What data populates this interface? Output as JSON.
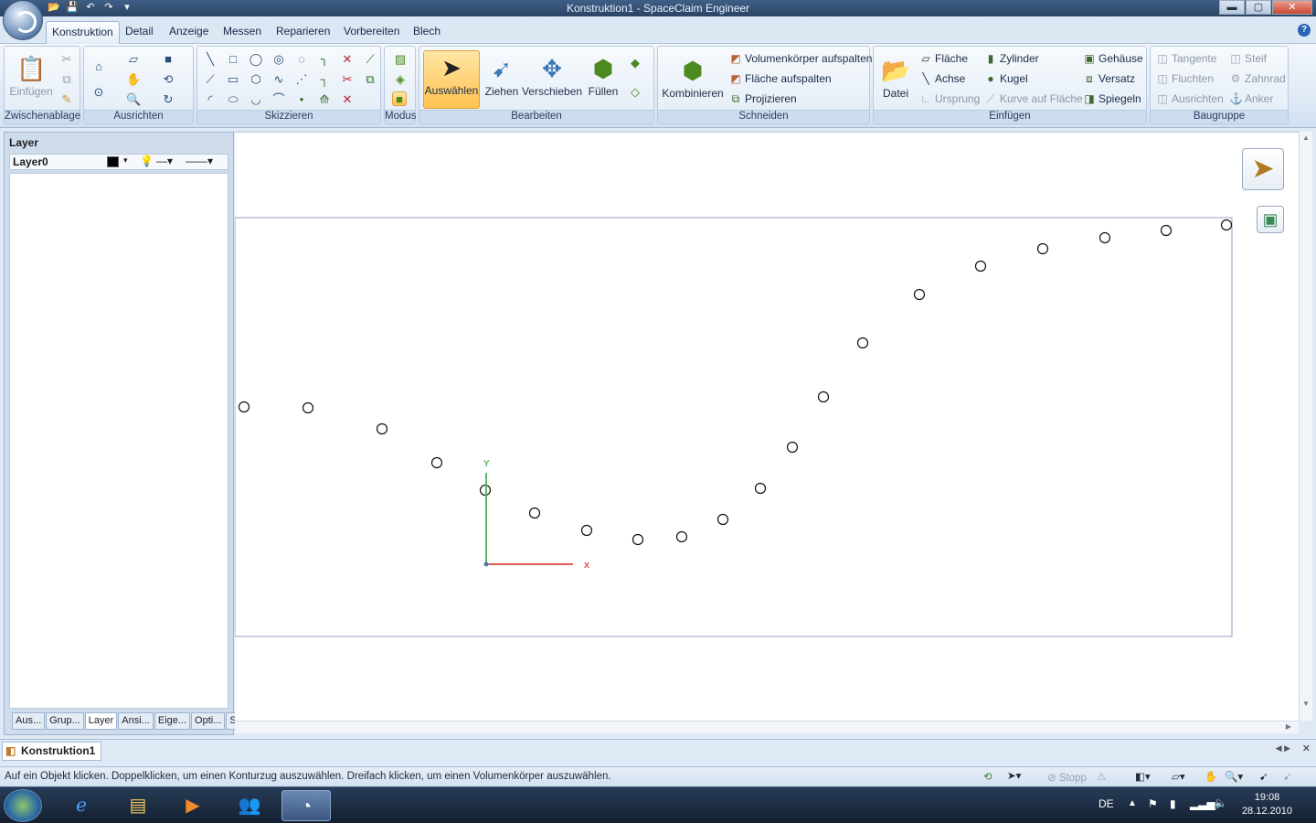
{
  "title": "Konstruktion1 - SpaceClaim Engineer",
  "window_buttons": {
    "minimize": "▬",
    "maximize": "▢",
    "close": "✕"
  },
  "qat_icons": [
    "open-icon",
    "save-icon",
    "undo-icon",
    "redo-icon",
    "customize-icon"
  ],
  "tabs": [
    {
      "label": "Konstruktion",
      "active": true
    },
    {
      "label": "Detail"
    },
    {
      "label": "Anzeige"
    },
    {
      "label": "Messen"
    },
    {
      "label": "Reparieren"
    },
    {
      "label": "Vorbereiten"
    },
    {
      "label": "Blech"
    }
  ],
  "ribbon": {
    "clipboard": {
      "label": "Zwischenablage",
      "paste": "Einfügen"
    },
    "orient": {
      "label": "Ausrichten"
    },
    "sketch": {
      "label": "Skizzieren"
    },
    "mode": {
      "label": "Modus"
    },
    "edit": {
      "label": "Bearbeiten",
      "select": "Auswählen",
      "pull": "Ziehen",
      "move": "Verschieben",
      "fill": "Füllen"
    },
    "intersect": {
      "label": "Schneiden",
      "combine": "Kombinieren",
      "split_body": "Volumenkörper aufspalten",
      "split_face": "Fläche aufspalten",
      "project": "Projizieren"
    },
    "insert": {
      "label": "Einfügen",
      "file": "Datei",
      "plane": "Fläche",
      "axis": "Achse",
      "origin": "Ursprung",
      "cylinder": "Zylinder",
      "sphere": "Kugel",
      "curve_on_face": "Kurve auf Fläche",
      "shell": "Gehäuse",
      "offset": "Versatz",
      "mirror": "Spiegeln"
    },
    "assembly": {
      "label": "Baugruppe",
      "tangent": "Tangente",
      "align": "Fluchten",
      "orient": "Ausrichten",
      "rigid": "Steif",
      "gear": "Zahnrad",
      "anchor": "Anker"
    }
  },
  "layer_panel": {
    "title": "Layer",
    "layer_name": "Layer0",
    "tabs": [
      "Aus...",
      "Grup...",
      "Layer",
      "Ansi...",
      "Eige...",
      "Opti...",
      "Stru..."
    ],
    "active_tab": "Layer"
  },
  "canvas": {
    "axis_x_label": "x",
    "axis_y_label": "Y"
  },
  "doc_tab": "Konstruktion1",
  "status_message": "Auf ein Objekt klicken. Doppelklicken, um einen Konturzug auszuwählen. Dreifach klicken, um einen Volumenkörper auszuwählen.",
  "status_stop": "Stopp",
  "taskbar": {
    "lang": "DE",
    "time": "19:08",
    "date": "28.12.2010"
  },
  "colors": {
    "axis_x": "#e05a50",
    "axis_y": "#5cb85c",
    "accent": "#ffc24e"
  }
}
